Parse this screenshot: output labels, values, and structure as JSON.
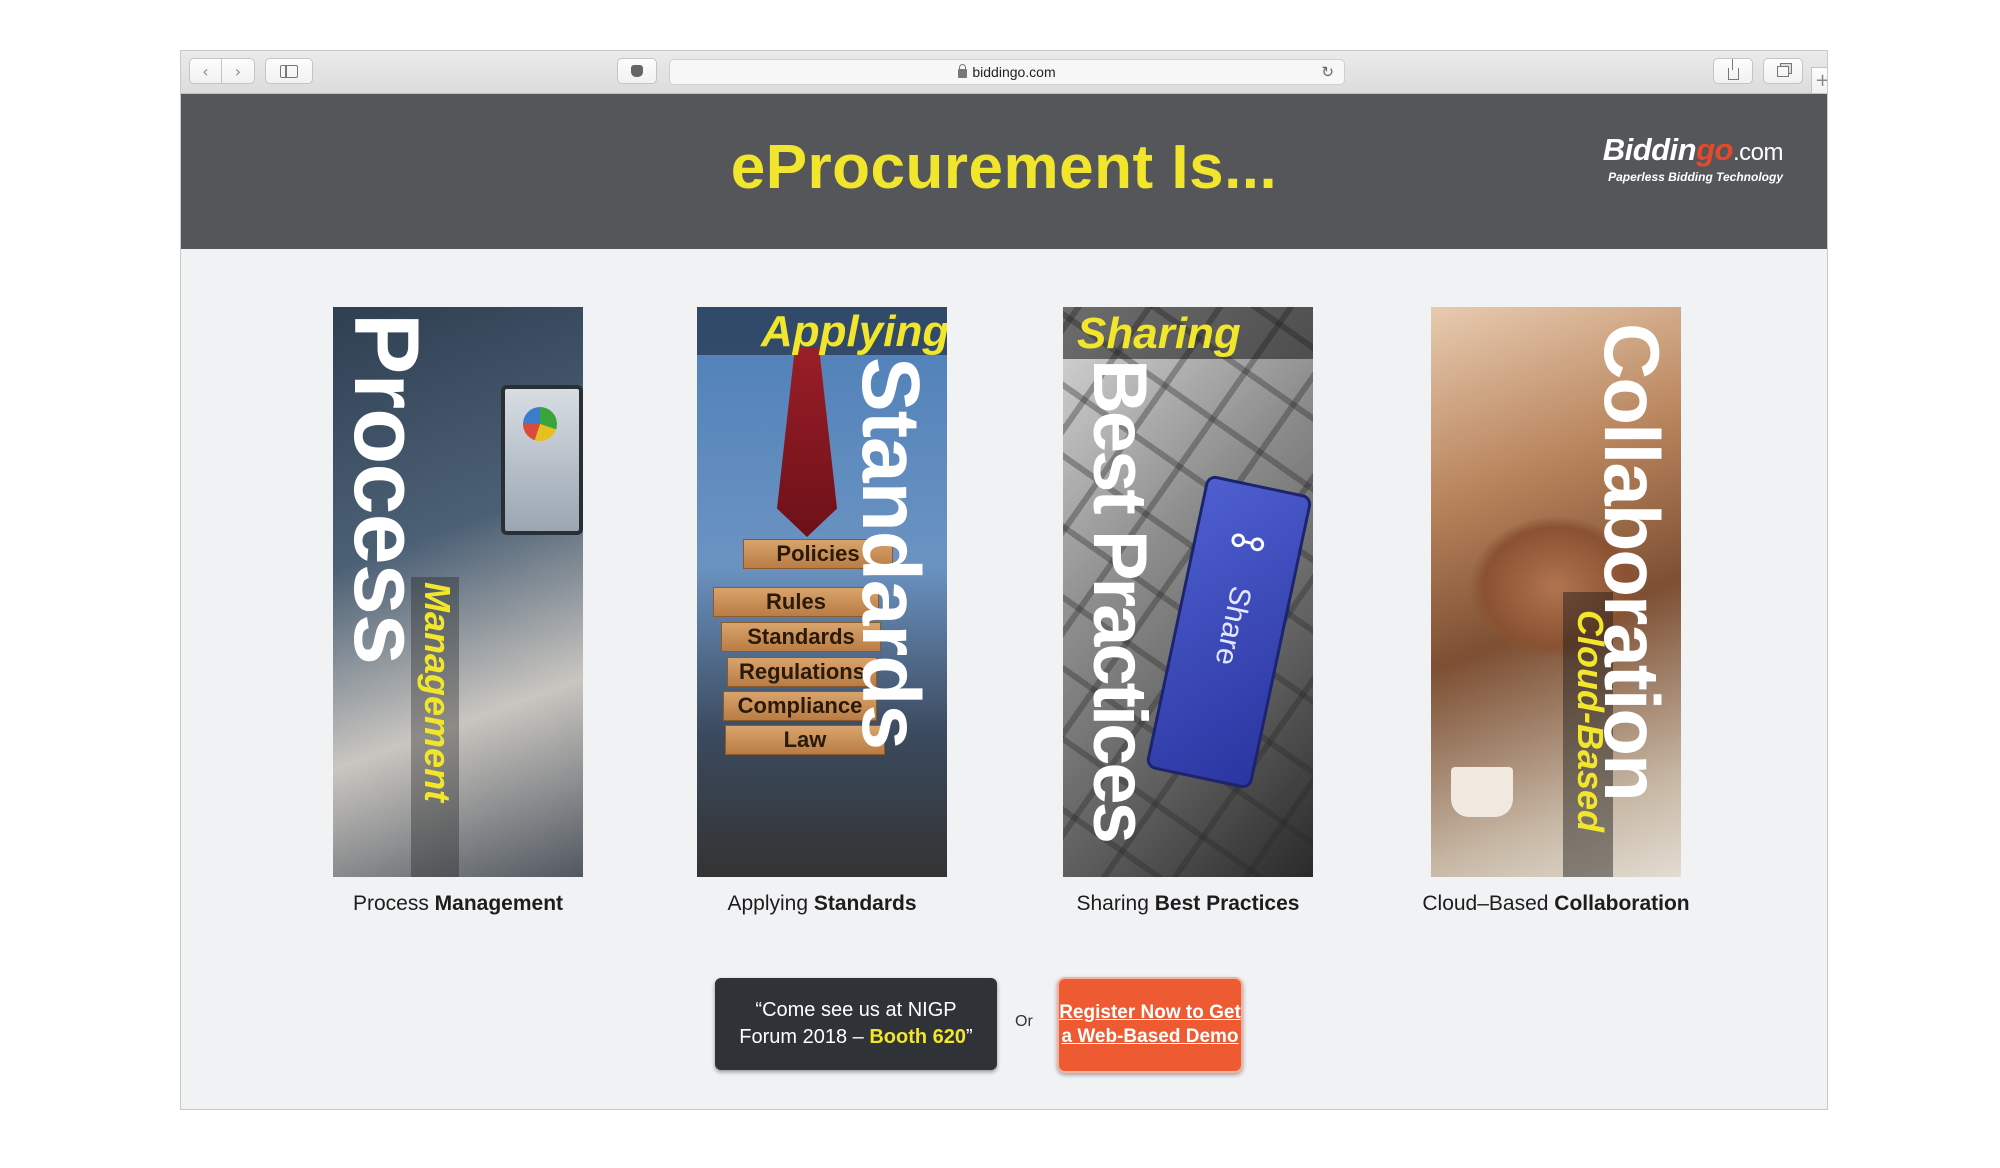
{
  "browser": {
    "url": "biddingo.com",
    "back_icon": "‹",
    "forward_icon": "›",
    "reload_icon": "↻"
  },
  "header": {
    "headline": "eProcurement Is...",
    "logo": {
      "part1": "Biddin",
      "part2": "go",
      "part3": ".com",
      "tagline": "Paperless Bidding Technology"
    }
  },
  "tiles": [
    {
      "big": "Process",
      "small": "Management",
      "caption_plain": "Process ",
      "caption_bold": "Management"
    },
    {
      "big": "Standards",
      "small": "Applying",
      "caption_plain": "Applying ",
      "caption_bold": "Standards",
      "blocks": [
        "Policies",
        "Rules",
        "Standards",
        "Regulations",
        "Compliance",
        "Law"
      ]
    },
    {
      "big": "Best Practices",
      "small": "Sharing",
      "key_text": "Share",
      "caption_plain": "Sharing ",
      "caption_bold": "Best Practices"
    },
    {
      "big": "Collaboration",
      "small": "Cloud-Based",
      "caption_plain": "Cloud–Based ",
      "caption_bold": "Collaboration"
    }
  ],
  "cta": {
    "booth_line1": "“Come see us at NIGP",
    "booth_line2_pre": "Forum 2018 – ",
    "booth_highlight": "Booth 620",
    "booth_close": "”",
    "or_text": "Or",
    "register": "Register Now to Get a Web-Based Demo"
  },
  "colors": {
    "accent_yellow": "#f2e62c",
    "header_gray": "#55565a",
    "cta_orange": "#ee5a32",
    "logo_red": "#e5492a"
  }
}
